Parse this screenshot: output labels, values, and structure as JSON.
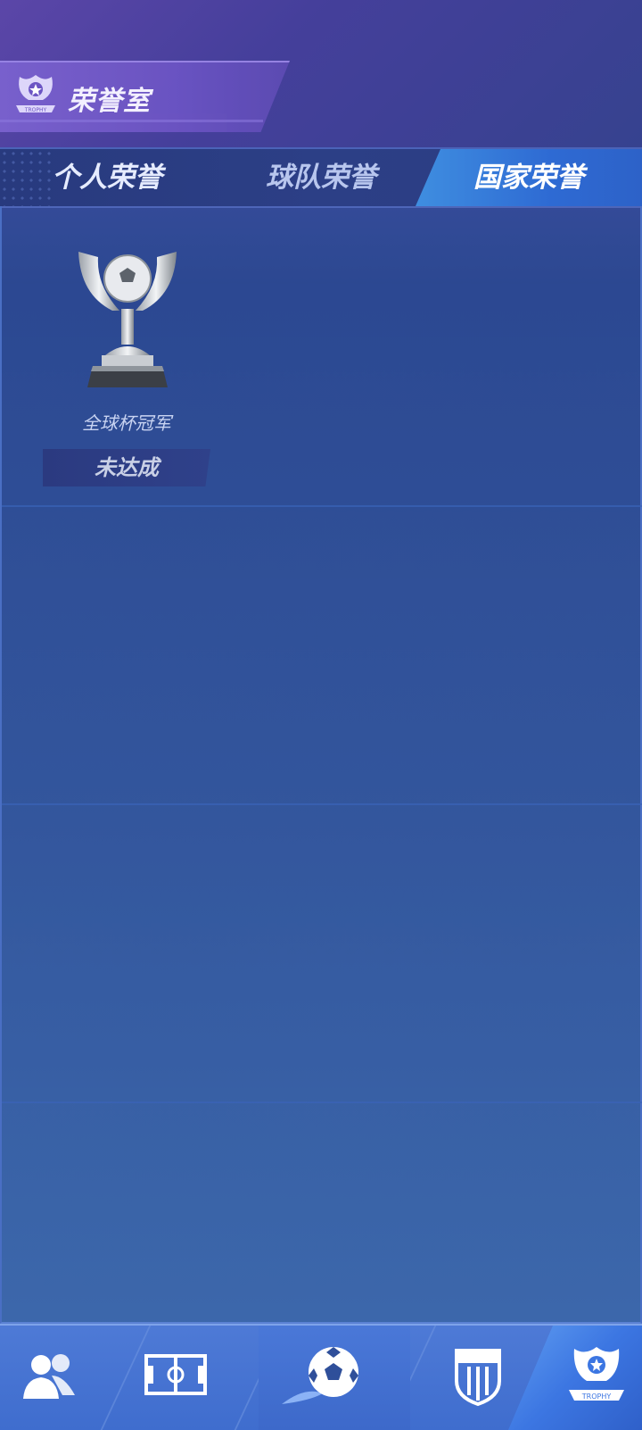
{
  "header": {
    "title": "荣誉室",
    "title_icon": "trophy-badge-icon"
  },
  "tabs": [
    {
      "label": "个人荣誉",
      "active": false
    },
    {
      "label": "球队荣誉",
      "active": false
    },
    {
      "label": "国家荣誉",
      "active": true
    }
  ],
  "honors": [
    {
      "name": "全球杯冠军",
      "status": "未达成",
      "icon": "silver-trophy-icon"
    }
  ],
  "bottom_nav": [
    {
      "icon": "players-icon",
      "active": false
    },
    {
      "icon": "field-icon",
      "active": false
    },
    {
      "icon": "soccer-ball-icon",
      "active": false
    },
    {
      "icon": "club-badge-icon",
      "active": false
    },
    {
      "icon": "trophy-icon",
      "active": true
    }
  ],
  "colors": {
    "accent": "#3f8ee0",
    "background": "#2a4e98",
    "header": "#6c55c4"
  }
}
